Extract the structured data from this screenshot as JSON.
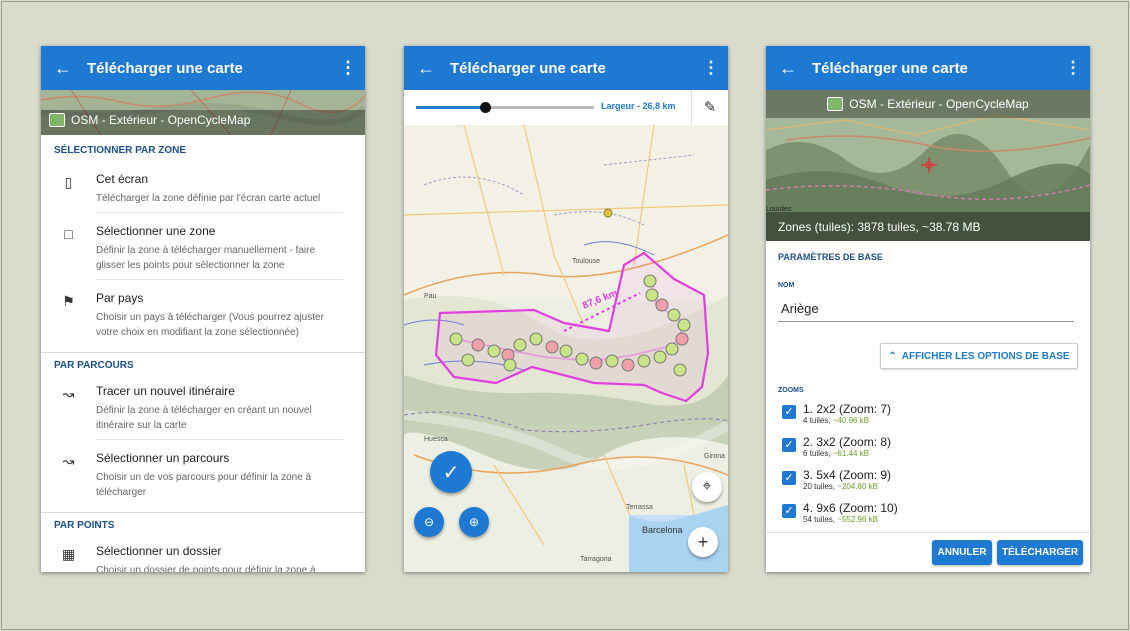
{
  "app_title": "Télécharger une carte",
  "map_name": "OSM - Extérieur - OpenCycleMap",
  "screen1": {
    "sections": [
      {
        "title": "SÉLECTIONNER PAR ZONE",
        "items": [
          {
            "icon": "screen-download-icon",
            "title": "Cet écran",
            "desc": "Télécharger la zone définie par l'écran carte actuel"
          },
          {
            "icon": "select-area-icon",
            "title": "Sélectionner une zone",
            "desc": "Définir la zone à télécharger manuellement - faire glisser les points pour sélectionner la zone"
          },
          {
            "icon": "flag-icon",
            "title": "Par pays",
            "desc": "Choisir un pays à télécharger (Vous pourrez ajuster votre choix en modifiant la zone sélectionnée)"
          }
        ]
      },
      {
        "title": "PAR PARCOURS",
        "items": [
          {
            "icon": "route-plot-icon",
            "title": "Tracer un nouvel itinéraire",
            "desc": "Définir la zone à télécharger en créant un nouvel itinéraire sur la carte"
          },
          {
            "icon": "track-select-icon",
            "title": "Sélectionner un parcours",
            "desc": "Choisir un de vos parcours pour définir la zone à télécharger"
          }
        ]
      },
      {
        "title": "PAR POINTS",
        "items": [
          {
            "icon": "folder-points-icon",
            "title": "Sélectionner un dossier",
            "desc": "Choisir un dossier de points pour définir la zone à télécharger (Vous pourrez ajuster votre choix en modifiant la zone sélectionnée)"
          }
        ]
      }
    ]
  },
  "screen2": {
    "width_label": "Largeur - 26,8 km",
    "width_fraction": 0.39,
    "distance_label": "87,6 km",
    "places": [
      "Toulouse",
      "Pau",
      "Huesca",
      "Girona",
      "Terrassa",
      "Barcelona",
      "Tarragona"
    ]
  },
  "screen3": {
    "place_label": "Lourdes",
    "zones_label": "Zones (tuiles): 3878 tuiles, ~38.78 MB",
    "section_base": "PARAMÈTRES DE BASE",
    "name_label": "NOM",
    "name_value": "Ariège",
    "options_button": "AFFICHER LES OPTIONS DE BASE",
    "zooms_label": "ZOOMS",
    "zooms": [
      {
        "title": "1. 2x2 (Zoom: 7)",
        "tiles": "4 tuiles,",
        "size": "~40.96 kB"
      },
      {
        "title": "2. 3x2 (Zoom: 8)",
        "tiles": "6 tuiles,",
        "size": "~61.44 kB"
      },
      {
        "title": "3. 5x4 (Zoom: 9)",
        "tiles": "20 tuiles,",
        "size": "~204.80 kB"
      },
      {
        "title": "4. 9x6 (Zoom: 10)",
        "tiles": "54 tuiles,",
        "size": "~552.96 kB"
      }
    ],
    "cancel": "ANNULER",
    "download": "TÉLÉCHARGER"
  },
  "colors": {
    "primary": "#1e79d2",
    "route": "#e23fe0",
    "section_title": "#1e4f8a"
  }
}
